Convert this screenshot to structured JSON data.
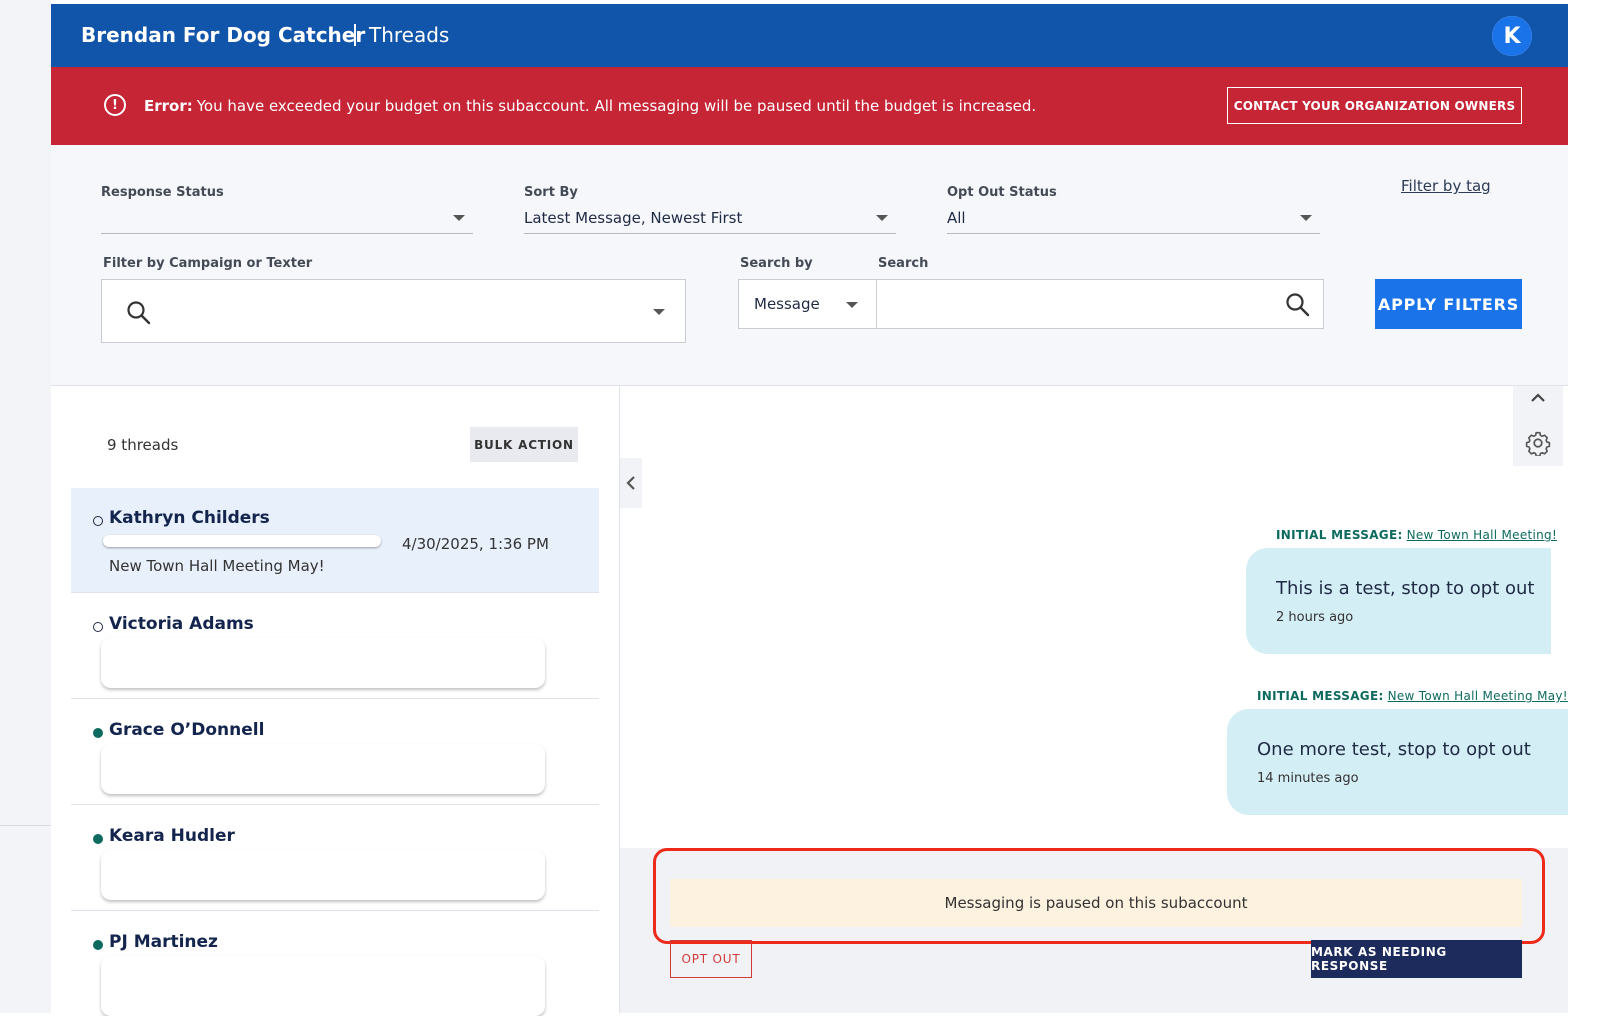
{
  "header": {
    "org_name": "Brendan For Dog Catcher",
    "section": "Threads",
    "avatar_initial": "K"
  },
  "error_banner": {
    "label": "Error:",
    "message": "You have exceeded your budget on this subaccount. All messaging will be paused until the budget is increased.",
    "contact_button": "CONTACT YOUR ORGANIZATION OWNERS",
    "color": "#c62536"
  },
  "filters": {
    "response_status": {
      "label": "Response Status",
      "value": ""
    },
    "sort_by": {
      "label": "Sort By",
      "value": "Latest Message, Newest First"
    },
    "opt_out_status": {
      "label": "Opt Out Status",
      "value": "All"
    },
    "filter_by_tag": "Filter by tag",
    "campaign": {
      "label": "Filter by Campaign or Texter",
      "value": ""
    },
    "search_by": {
      "label": "Search by",
      "value": "Message"
    },
    "search": {
      "label": "Search",
      "value": ""
    },
    "apply_button": "APPLY FILTERS"
  },
  "threads": {
    "count_label": "9 threads",
    "bulk_action": "BULK ACTION",
    "items": [
      {
        "name": "Kathryn Childers",
        "date": "4/30/2025, 1:36 PM",
        "preview": "New Town Hall Meeting May!",
        "selected": true,
        "status": "open"
      },
      {
        "name": "Victoria Adams",
        "status": "open"
      },
      {
        "name": "Grace O’Donnell",
        "status": "filled"
      },
      {
        "name": "Keara Hudler",
        "status": "filled"
      },
      {
        "name": "PJ Martinez",
        "status": "filled"
      }
    ]
  },
  "conversation": {
    "messages": [
      {
        "initial_label": "INITIAL MESSAGE:",
        "campaign": "New Town Hall Meeting!",
        "text": "This is a test, stop to opt out",
        "time": "2 hours ago"
      },
      {
        "initial_label": "INITIAL MESSAGE:",
        "campaign": "New Town Hall Meeting May!",
        "text": "One more test, stop to opt out",
        "time": "14 minutes ago"
      }
    ],
    "paused_notice": "Messaging is paused on this subaccount",
    "opt_out_button": "OPT OUT",
    "mark_button": "MARK AS NEEDING RESPONSE"
  },
  "colors": {
    "header_blue": "#1155ab",
    "accent_blue": "#1a73e8",
    "bubble": "#d4eef5",
    "highlight_red": "#ee2a1b"
  },
  "icons": [
    "alert-circle-icon",
    "search-icon",
    "chevron-down-icon",
    "chevron-left-icon",
    "chevron-up-icon",
    "gear-icon"
  ]
}
